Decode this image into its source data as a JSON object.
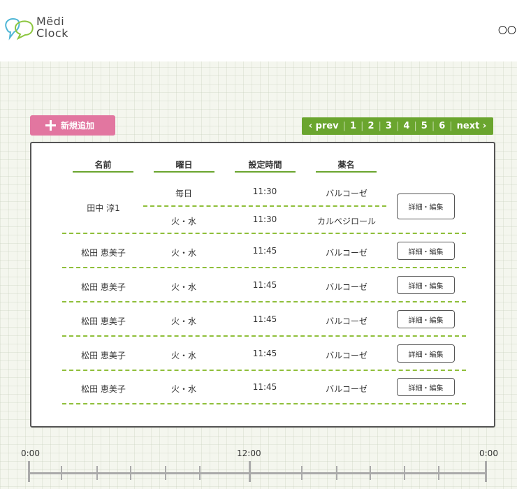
{
  "header": {
    "logo_line1": "Mëdi",
    "logo_line2": "Clock",
    "right_text": "〇〇で"
  },
  "toolbar": {
    "add_label": "新規追加"
  },
  "pagination": {
    "prev": "‹ prev",
    "pages": [
      "1",
      "2",
      "3",
      "4",
      "5",
      "6"
    ],
    "next": "next ›"
  },
  "table": {
    "headers": [
      "名前",
      "曜日",
      "設定時間",
      "薬名"
    ],
    "rows": [
      {
        "name": "田中 淳1",
        "entries": [
          {
            "days": "毎日",
            "time": "11:30",
            "medicine": "バルコーゼ"
          },
          {
            "days": "火・水",
            "time": "11:30",
            "medicine": "カルベジロール"
          }
        ],
        "action": "詳細・編集"
      },
      {
        "name": "松田 恵美子",
        "entries": [
          {
            "days": "火・水",
            "time": "11:45",
            "medicine": "バルコーゼ"
          }
        ],
        "action": "詳細・編集"
      },
      {
        "name": "松田 恵美子",
        "entries": [
          {
            "days": "火・水",
            "time": "11:45",
            "medicine": "バルコーゼ"
          }
        ],
        "action": "詳細・編集"
      },
      {
        "name": "松田 恵美子",
        "entries": [
          {
            "days": "火・水",
            "time": "11:45",
            "medicine": "バルコーゼ"
          }
        ],
        "action": "詳細・編集"
      },
      {
        "name": "松田 恵美子",
        "entries": [
          {
            "days": "火・水",
            "time": "11:45",
            "medicine": "バルコーゼ"
          }
        ],
        "action": "詳細・編集"
      },
      {
        "name": "松田 恵美子",
        "entries": [
          {
            "days": "火・水",
            "time": "11:45",
            "medicine": "バルコーゼ"
          }
        ],
        "action": "詳細・編集"
      }
    ]
  },
  "timeline": {
    "start_label": "0:00",
    "mid_label": "12:00",
    "end_label": "0:00"
  },
  "colors": {
    "accent_green": "#6aa52e",
    "accent_pink": "#e276a0",
    "dash_green": "#8fbf3a"
  },
  "icons": [
    "logo-bubbles-icon",
    "plus-icon"
  ]
}
